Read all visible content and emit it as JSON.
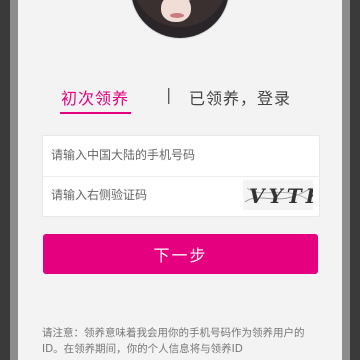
{
  "tabs": {
    "first_claim": "初次领养",
    "divider": "|",
    "already_claimed": "已领养，登录"
  },
  "form": {
    "phone_placeholder": "请输入中国大陆的手机号码",
    "code_placeholder": "请输入右侧验证码",
    "captcha_text": "VYTK"
  },
  "buttons": {
    "next_label": "下一步"
  },
  "notice": {
    "text": "请注意：领养意味着我会用你的手机号码作为领养用户的ID。在领养期间，你的个人信息将与领养ID"
  },
  "colors": {
    "accent": "#e4007f",
    "background": "#f3f3f3"
  },
  "icons": {
    "avatar": "profile-photo"
  }
}
